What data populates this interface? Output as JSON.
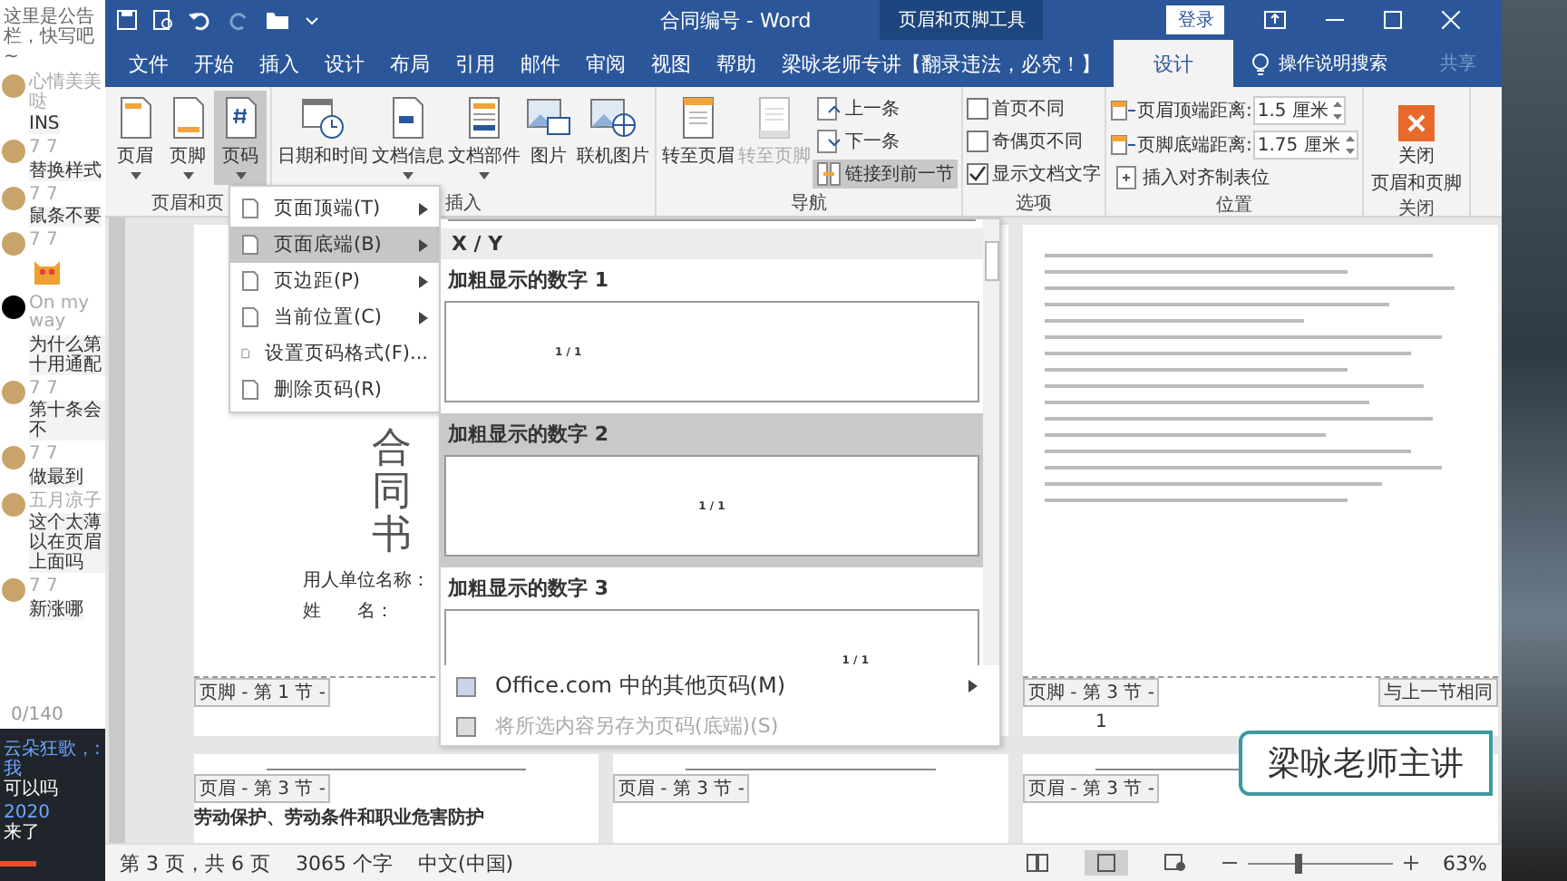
{
  "chat": {
    "notice": "这里是公告栏，快写吧~",
    "messages": [
      {
        "kind": "text",
        "name": "心情美美哒",
        "text": "INS",
        "dark_avatar": false
      },
      {
        "kind": "text",
        "name": "7 7",
        "text": "替换样式",
        "dark_avatar": false
      },
      {
        "kind": "text",
        "name": "7 7",
        "text": "鼠条不要",
        "dark_avatar": false
      },
      {
        "kind": "sticker",
        "name": "7 7",
        "dark_avatar": false
      },
      {
        "kind": "text",
        "name": "On my way",
        "text": "为什么第十用通配",
        "dark_avatar": true
      },
      {
        "kind": "text",
        "name": "7 7",
        "text": "第十条会不",
        "dark_avatar": false
      },
      {
        "kind": "text",
        "name": "7 7",
        "text": "做最到",
        "dark_avatar": false
      },
      {
        "kind": "text",
        "name": "五月凉子",
        "text": "这个太薄以在页眉上面吗",
        "dark_avatar": false
      },
      {
        "kind": "text",
        "name": "7 7",
        "text": "新涨哪",
        "dark_avatar": false
      }
    ],
    "counter": "0/140",
    "live": [
      {
        "user": "云朵狂歌，: 我",
        "text": "可以吗"
      },
      {
        "user": "2020",
        "text": "来了"
      }
    ]
  },
  "window": {
    "title": "合同编号 - Word",
    "context_tab": "页眉和页脚工具",
    "login": "登录"
  },
  "tabs": [
    {
      "label": "文件",
      "selected": false
    },
    {
      "label": "开始",
      "selected": false
    },
    {
      "label": "插入",
      "selected": false
    },
    {
      "label": "设计",
      "selected": false
    },
    {
      "label": "布局",
      "selected": false
    },
    {
      "label": "引用",
      "selected": false
    },
    {
      "label": "邮件",
      "selected": false
    },
    {
      "label": "审阅",
      "selected": false
    },
    {
      "label": "视图",
      "selected": false
    },
    {
      "label": "帮助",
      "selected": false
    },
    {
      "label": "梁咏老师专讲【翻录违法，必究！】",
      "selected": false
    },
    {
      "label": "设计",
      "selected": true
    }
  ],
  "search": {
    "placeholder": "操作说明搜索"
  },
  "share": "共享",
  "ribbon": {
    "groups": [
      {
        "label": "页眉和页",
        "items": [
          {
            "kind": "large",
            "label": "页眉",
            "dropdown": true,
            "pressed": false,
            "disabled": false
          },
          {
            "kind": "large",
            "label": "页脚",
            "dropdown": true,
            "pressed": false,
            "disabled": false
          },
          {
            "kind": "large",
            "label": "页码",
            "dropdown": true,
            "pressed": true,
            "disabled": false
          }
        ]
      },
      {
        "label": "插入",
        "items": [
          {
            "kind": "large",
            "label": "日期和时间",
            "dropdown": false,
            "pressed": false,
            "disabled": false
          },
          {
            "kind": "large",
            "label": "文档信息",
            "dropdown": true,
            "pressed": false,
            "disabled": false
          },
          {
            "kind": "large",
            "label": "文档部件",
            "dropdown": true,
            "pressed": false,
            "disabled": false
          },
          {
            "kind": "large",
            "label": "图片",
            "dropdown": false,
            "pressed": false,
            "disabled": false
          },
          {
            "kind": "large",
            "label": "联机图片",
            "dropdown": false,
            "pressed": false,
            "disabled": false
          }
        ]
      },
      {
        "label": "导航",
        "items": [
          {
            "kind": "large",
            "label": "转至页眉",
            "dropdown": false,
            "pressed": false,
            "disabled": false
          },
          {
            "kind": "large",
            "label": "转至页脚",
            "dropdown": false,
            "pressed": false,
            "disabled": true
          },
          {
            "kind": "small",
            "label": "上一条",
            "pressed": false,
            "disabled": false
          },
          {
            "kind": "small",
            "label": "下一条",
            "pressed": false,
            "disabled": false
          },
          {
            "kind": "small",
            "label": "链接到前一节",
            "pressed": true,
            "disabled": false
          }
        ]
      },
      {
        "label": "选项",
        "items": [
          {
            "kind": "check",
            "label": "首页不同",
            "checked": false
          },
          {
            "kind": "check",
            "label": "奇偶页不同",
            "checked": false
          },
          {
            "kind": "check",
            "label": "显示文档文字",
            "checked": true
          }
        ]
      },
      {
        "label": "位置",
        "items": [
          {
            "kind": "spin",
            "label": "页眉顶端距离:",
            "value": "1.5 厘米"
          },
          {
            "kind": "spin",
            "label": "页脚底端距离:",
            "value": "1.75 厘米"
          },
          {
            "kind": "small",
            "label": "插入对齐制表位",
            "pressed": false,
            "disabled": false
          }
        ]
      },
      {
        "label": "关闭",
        "items": [
          {
            "kind": "close",
            "label_lines": [
              "关闭",
              "页眉和页脚"
            ]
          }
        ]
      }
    ]
  },
  "page_number_menu": [
    {
      "label": "页面顶端(T)",
      "submenu": true,
      "selected": false
    },
    {
      "label": "页面底端(B)",
      "submenu": true,
      "selected": true
    },
    {
      "label": "页边距(P)",
      "submenu": true,
      "selected": false
    },
    {
      "label": "当前位置(C)",
      "submenu": true,
      "selected": false
    },
    {
      "label": "设置页码格式(F)...",
      "submenu": false,
      "selected": false
    },
    {
      "label": "删除页码(R)",
      "submenu": false,
      "selected": false
    }
  ],
  "gallery": {
    "section": "X / Y",
    "items": [
      {
        "title": "加粗显示的数字 1",
        "preview": "1 / 1",
        "kind": "left",
        "selected": false
      },
      {
        "title": "加粗显示的数字 2",
        "preview": "1 / 1",
        "kind": "center",
        "selected": true
      },
      {
        "title": "加粗显示的数字 3",
        "preview": "1 / 1",
        "kind": "right",
        "selected": false
      }
    ],
    "footer": [
      {
        "label": "Office.com 中的其他页码(M)",
        "submenu": true,
        "disabled": false
      },
      {
        "label": "将所选内容另存为页码(底端)(S)",
        "submenu": false,
        "disabled": true
      }
    ]
  },
  "pages": {
    "title": [
      "合",
      "同",
      "书"
    ],
    "fields": [
      "用人单位名称：",
      "姓　　名："
    ],
    "footer_tags": [
      "页脚 - 第 1 节 -",
      "页脚 - 第 3 节 -"
    ],
    "same_as_previous": "与上一节相同",
    "page_number": "1",
    "header_tags": [
      "页眉 - 第 3 节 -",
      "页眉 - 第 3 节 -",
      "页眉 - 第 3 节 -"
    ],
    "heading": "劳动保护、劳动条件和职业危害防护"
  },
  "status_bar": {
    "page": "第 3 页，共 6 页",
    "words": "3065 个字",
    "language": "中文(中国)",
    "views": [
      {
        "selected": false
      },
      {
        "selected": true
      },
      {
        "selected": false
      }
    ],
    "zoom": {
      "level": 0.35,
      "reading": "63%"
    }
  },
  "caption": "梁咏老师主讲"
}
